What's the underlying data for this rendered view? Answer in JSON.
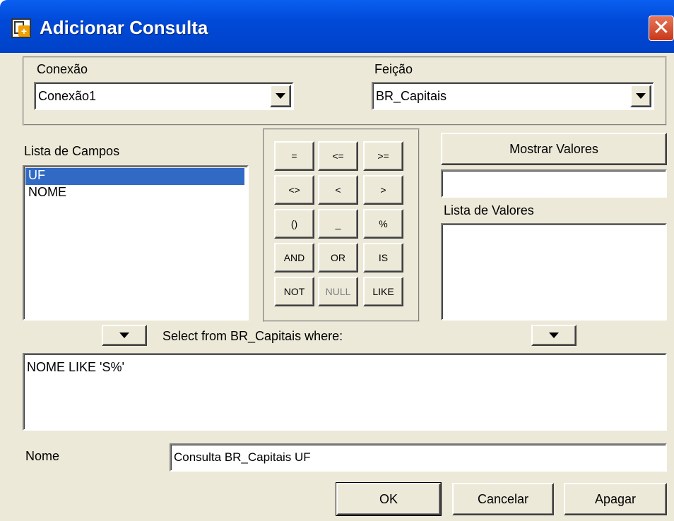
{
  "window": {
    "title": "Adicionar Consulta",
    "close_glyph": "✕"
  },
  "connection": {
    "label": "Conexão",
    "value": "Conexão1"
  },
  "feature": {
    "label": "Feição",
    "value": "BR_Capitais"
  },
  "fields": {
    "label": "Lista de Campos",
    "items": [
      "UF",
      "NOME"
    ],
    "selected_index": 0
  },
  "operators": {
    "row1": [
      "=",
      "<=",
      ">="
    ],
    "row2": [
      "<>",
      "<",
      ">"
    ],
    "row3": [
      "()",
      "_",
      "%"
    ],
    "row4": [
      "AND",
      "OR",
      "IS"
    ],
    "row5": [
      "NOT",
      "NULL",
      "LIKE"
    ]
  },
  "values": {
    "show_button": "Mostrar Valores",
    "filter_value": "",
    "list_label": "Lista de Valores",
    "items": []
  },
  "query": {
    "prefix_text": "Select from BR_Capitais where:",
    "expression": "NOME LIKE 'S%'"
  },
  "name": {
    "label": "Nome",
    "value": "Consulta BR_Capitais UF"
  },
  "actions": {
    "ok": "OK",
    "cancel": "Cancelar",
    "clear": "Apagar"
  },
  "colors": {
    "titlebar": "#0049d8",
    "dialog_bg": "#ece9d8",
    "selection": "#316ac5",
    "close": "#c8381a"
  }
}
